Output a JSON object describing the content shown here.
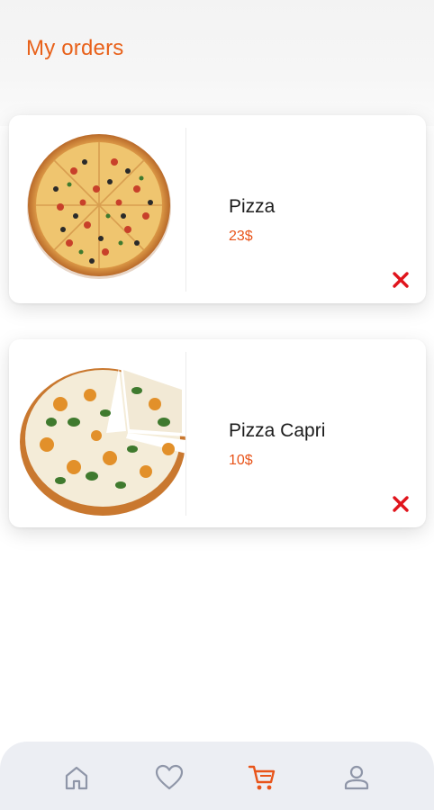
{
  "header": {
    "title": "My orders"
  },
  "orders": [
    {
      "name": "Pizza",
      "price": "23$",
      "image_icon": "pizza-whole-image",
      "remove_icon": "close-icon"
    },
    {
      "name": "Pizza Capri",
      "price": "10$",
      "image_icon": "pizza-sliced-image",
      "remove_icon": "close-icon"
    }
  ],
  "nav": {
    "items": [
      {
        "icon": "home-icon",
        "active": false
      },
      {
        "icon": "heart-icon",
        "active": false
      },
      {
        "icon": "cart-icon",
        "active": true
      },
      {
        "icon": "profile-icon",
        "active": false
      }
    ]
  },
  "colors": {
    "accent": "#e8611a",
    "price": "#e8541a",
    "remove": "#e0141c",
    "nav_inactive": "#8f96a8",
    "nav_bg": "#eceef3"
  }
}
